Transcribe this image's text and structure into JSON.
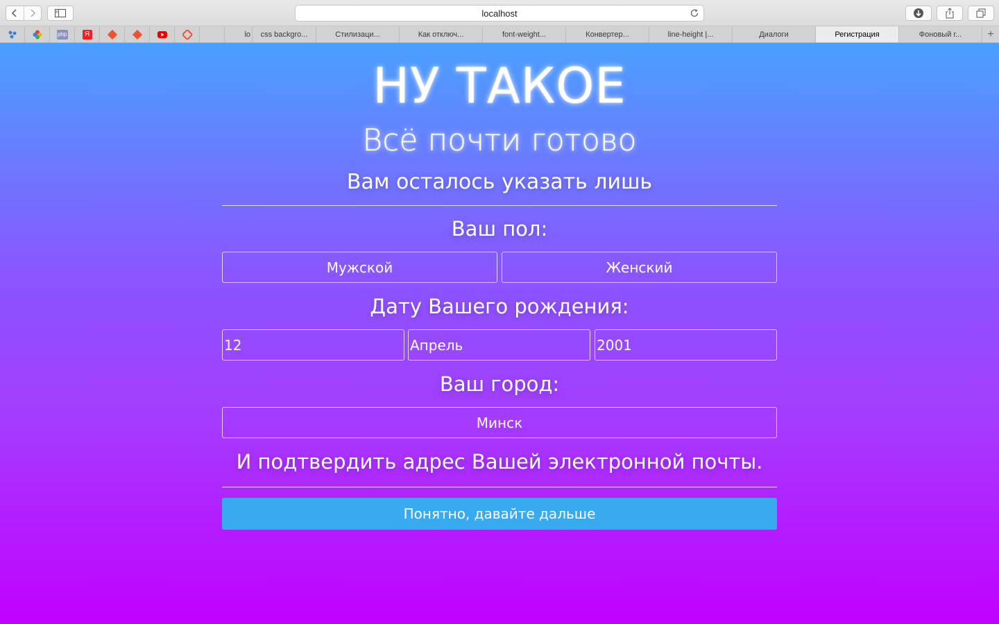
{
  "browser": {
    "url": "localhost",
    "tabs": [
      "lo",
      "css backgro...",
      "Стилизаци...",
      "Как отключ...",
      "font-weight...",
      "Конвертер...",
      "line-height |...",
      "Диалоги",
      "Регистрация",
      "Фоновый г..."
    ],
    "active_tab": "Регистрация",
    "pinned_icons": [
      "scatter-icon",
      "flower-icon",
      "php-icon",
      "yandex-icon",
      "git-icon",
      "git-icon",
      "youtube-icon",
      "git-icon"
    ],
    "pinned_labels": {
      "php": "php",
      "yandex": "Я"
    }
  },
  "page": {
    "logo": "НУ ТАКОЕ",
    "title": "Всё почти готово",
    "subtitle": "Вам осталось указать лишь",
    "gender_label": "Ваш пол:",
    "gender_options": [
      "Мужской",
      "Женский"
    ],
    "birth_label": "Дату Вашего рождения:",
    "birth": {
      "day": "12",
      "month": "Апрель",
      "year": "2001"
    },
    "city_label": "Ваш город:",
    "city": "Минск",
    "confirm_text": "И подтвердить адрес Вашей электронной почты.",
    "submit": "Понятно, давайте дальше"
  },
  "colors": {
    "gradient_top": "#4aa0fe",
    "gradient_bottom": "#c100ff",
    "button": "#38aaf0"
  }
}
